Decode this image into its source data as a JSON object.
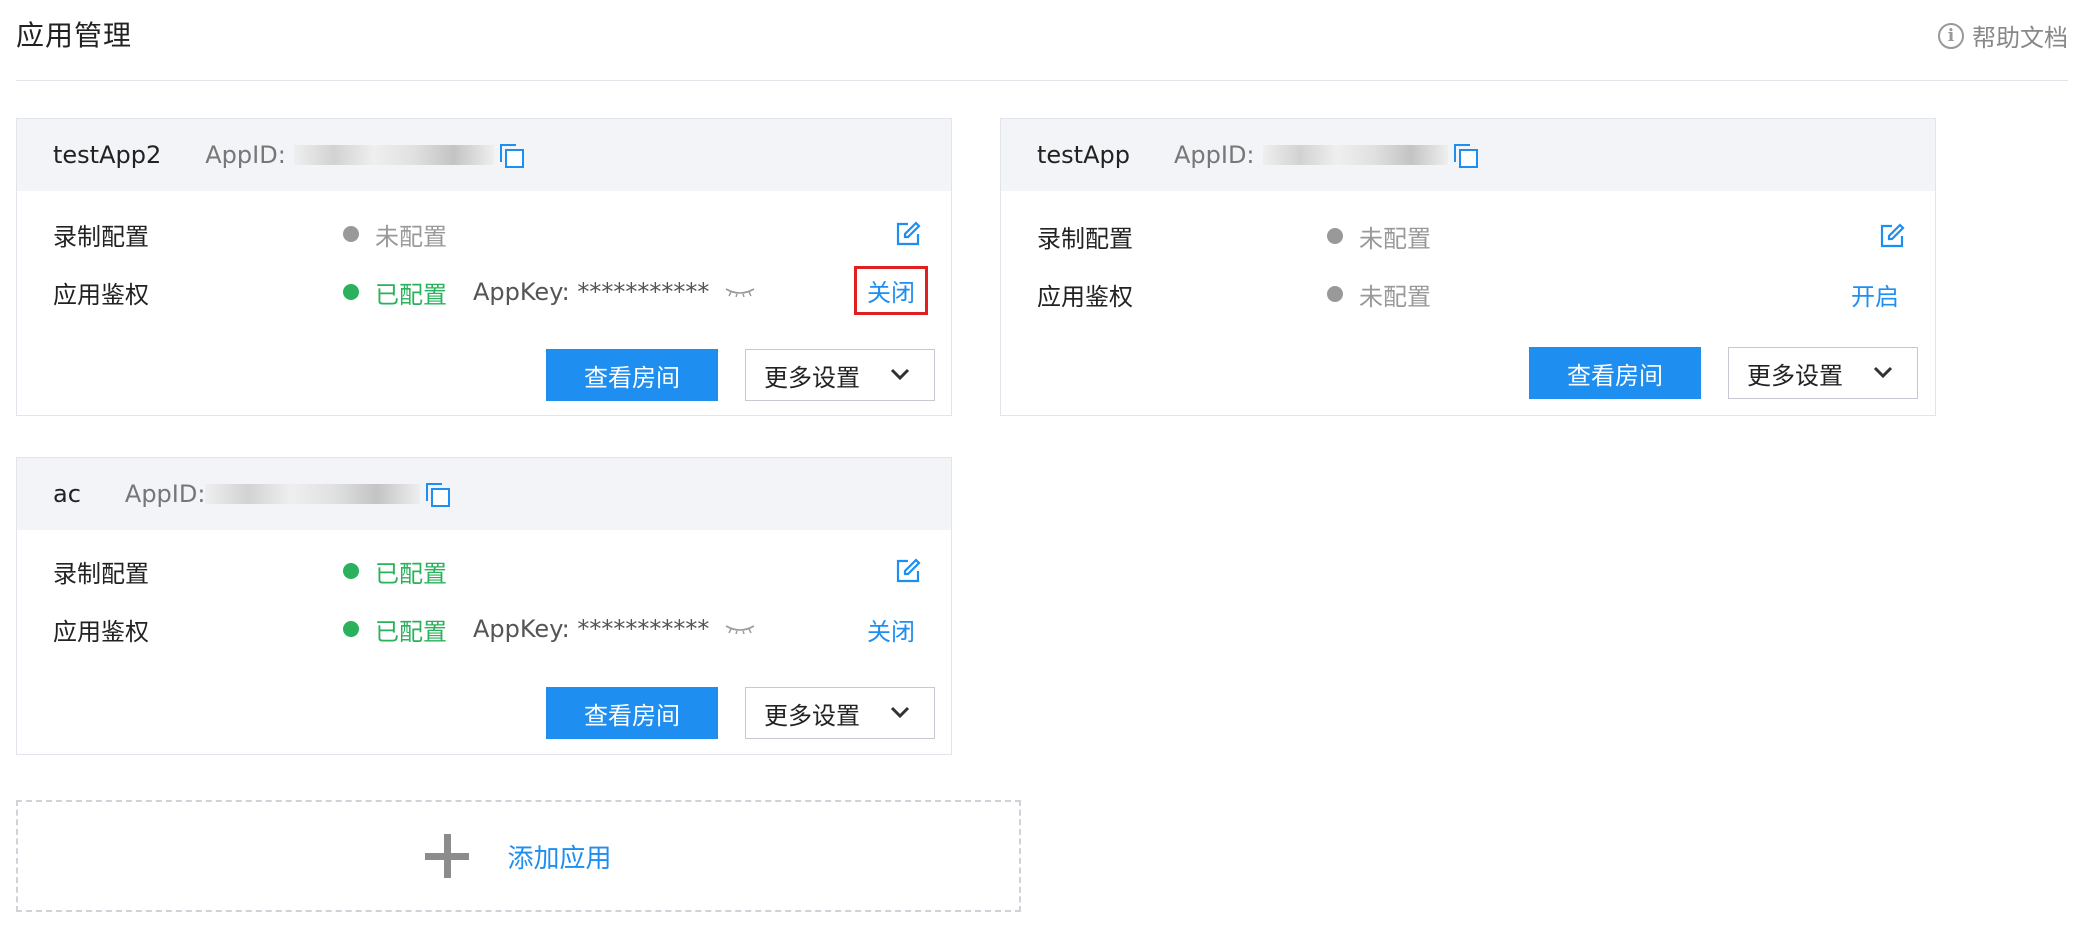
{
  "header": {
    "title": "应用管理",
    "help_icon": "i",
    "help_label": "帮助文档"
  },
  "apps": [
    {
      "name": "testApp2",
      "appid_label": "AppID:",
      "record": {
        "label": "录制配置",
        "status": "未配置"
      },
      "auth": {
        "label": "应用鉴权",
        "status": "已配置",
        "appkey": "AppKey: ***********",
        "action": "关闭"
      },
      "view_rooms": "查看房间",
      "more_settings": "更多设置"
    },
    {
      "name": "testApp",
      "appid_label": "AppID:",
      "record": {
        "label": "录制配置",
        "status": "未配置"
      },
      "auth": {
        "label": "应用鉴权",
        "status": "未配置",
        "action": "开启"
      },
      "view_rooms": "查看房间",
      "more_settings": "更多设置"
    },
    {
      "name": "ac",
      "appid_label": "AppID:",
      "record": {
        "label": "录制配置",
        "status": "已配置"
      },
      "auth": {
        "label": "应用鉴权",
        "status": "已配置",
        "appkey": "AppKey: ***********",
        "action": "关闭"
      },
      "view_rooms": "查看房间",
      "more_settings": "更多设置"
    }
  ],
  "add_app": {
    "label": "添加应用"
  },
  "colors": {
    "accent": "#1f8ef1",
    "configured": "#29b25b",
    "unconfigured": "#999999",
    "highlight_border": "#e02020"
  }
}
